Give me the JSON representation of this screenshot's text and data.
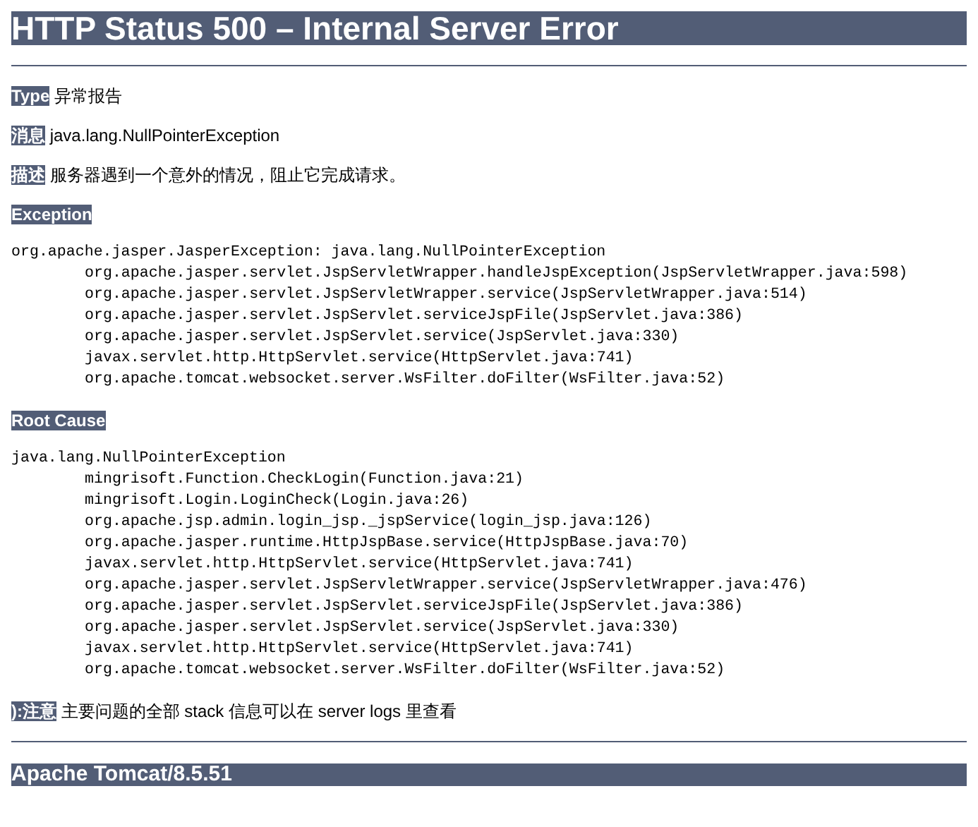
{
  "title": "HTTP Status 500 – Internal Server Error",
  "fields": [
    {
      "label": "Type",
      "value": "异常报告"
    },
    {
      "label": "消息",
      "value": "java.lang.NullPointerException"
    },
    {
      "label": "描述",
      "value": "服务器遇到一个意外的情况，阻止它完成请求。"
    }
  ],
  "sections": [
    {
      "heading": "Exception",
      "lines": [
        {
          "text": "org.apache.jasper.JasperException: java.lang.NullPointerException",
          "indented": false
        },
        {
          "text": "org.apache.jasper.servlet.JspServletWrapper.handleJspException(JspServletWrapper.java:598)",
          "indented": true
        },
        {
          "text": "org.apache.jasper.servlet.JspServletWrapper.service(JspServletWrapper.java:514)",
          "indented": true
        },
        {
          "text": "org.apache.jasper.servlet.JspServlet.serviceJspFile(JspServlet.java:386)",
          "indented": true
        },
        {
          "text": "org.apache.jasper.servlet.JspServlet.service(JspServlet.java:330)",
          "indented": true
        },
        {
          "text": "javax.servlet.http.HttpServlet.service(HttpServlet.java:741)",
          "indented": true
        },
        {
          "text": "org.apache.tomcat.websocket.server.WsFilter.doFilter(WsFilter.java:52)",
          "indented": true
        }
      ]
    },
    {
      "heading": "Root Cause",
      "lines": [
        {
          "text": "java.lang.NullPointerException",
          "indented": false
        },
        {
          "text": "mingrisoft.Function.CheckLogin(Function.java:21)",
          "indented": true
        },
        {
          "text": "mingrisoft.Login.LoginCheck(Login.java:26)",
          "indented": true
        },
        {
          "text": "org.apache.jsp.admin.login_jsp._jspService(login_jsp.java:126)",
          "indented": true
        },
        {
          "text": "org.apache.jasper.runtime.HttpJspBase.service(HttpJspBase.java:70)",
          "indented": true
        },
        {
          "text": "javax.servlet.http.HttpServlet.service(HttpServlet.java:741)",
          "indented": true
        },
        {
          "text": "org.apache.jasper.servlet.JspServletWrapper.service(JspServletWrapper.java:476)",
          "indented": true
        },
        {
          "text": "org.apache.jasper.servlet.JspServlet.serviceJspFile(JspServlet.java:386)",
          "indented": true
        },
        {
          "text": "org.apache.jasper.servlet.JspServlet.service(JspServlet.java:330)",
          "indented": true
        },
        {
          "text": "javax.servlet.http.HttpServlet.service(HttpServlet.java:741)",
          "indented": true
        },
        {
          "text": "org.apache.tomcat.websocket.server.WsFilter.doFilter(WsFilter.java:52)",
          "indented": true
        }
      ]
    }
  ],
  "note": {
    "label": "):注意",
    "value": "主要问题的全部 stack 信息可以在 server logs 里查看"
  },
  "footer": "Apache Tomcat/8.5.51"
}
